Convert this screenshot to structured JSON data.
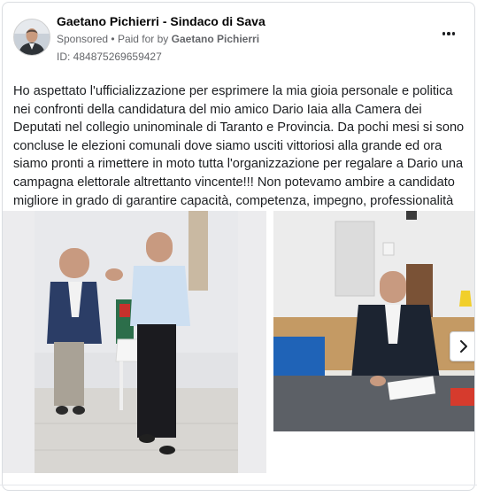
{
  "post": {
    "page_name": "Gaetano Pichierri - Sindaco di Sava",
    "sponsored": "Sponsored",
    "paid_for_prefix": "Paid for by",
    "paid_for_name": "Gaetano Pichierri",
    "ad_id": "ID: 484875269659427",
    "text": "Ho aspettato l'ufficializzazione per esprimere la mia gioia personale e politica nei confronti della candidatura del mio amico Dario Iaia alla Camera dei Deputati nel collegio uninominale di Taranto e Provincia. Da pochi mesi si sono concluse le elezioni comunali dove siamo usciti vittoriosi alla grande ed ora siamo pronti a rimettere in moto tutta l'organizzazione per regalare a Dario una campagna elettorale altrettanto vincente!!! Non potevamo ambire a candidato migliore in grado di garantire capacità, competenza, impegno, professionalità ed equilibrio,…"
  },
  "icons": {
    "more": "more-options-icon",
    "next": "chevron-right-icon"
  },
  "colors": {
    "text": "#1c1e21",
    "secondary": "#65676b",
    "border": "#dadde1"
  }
}
